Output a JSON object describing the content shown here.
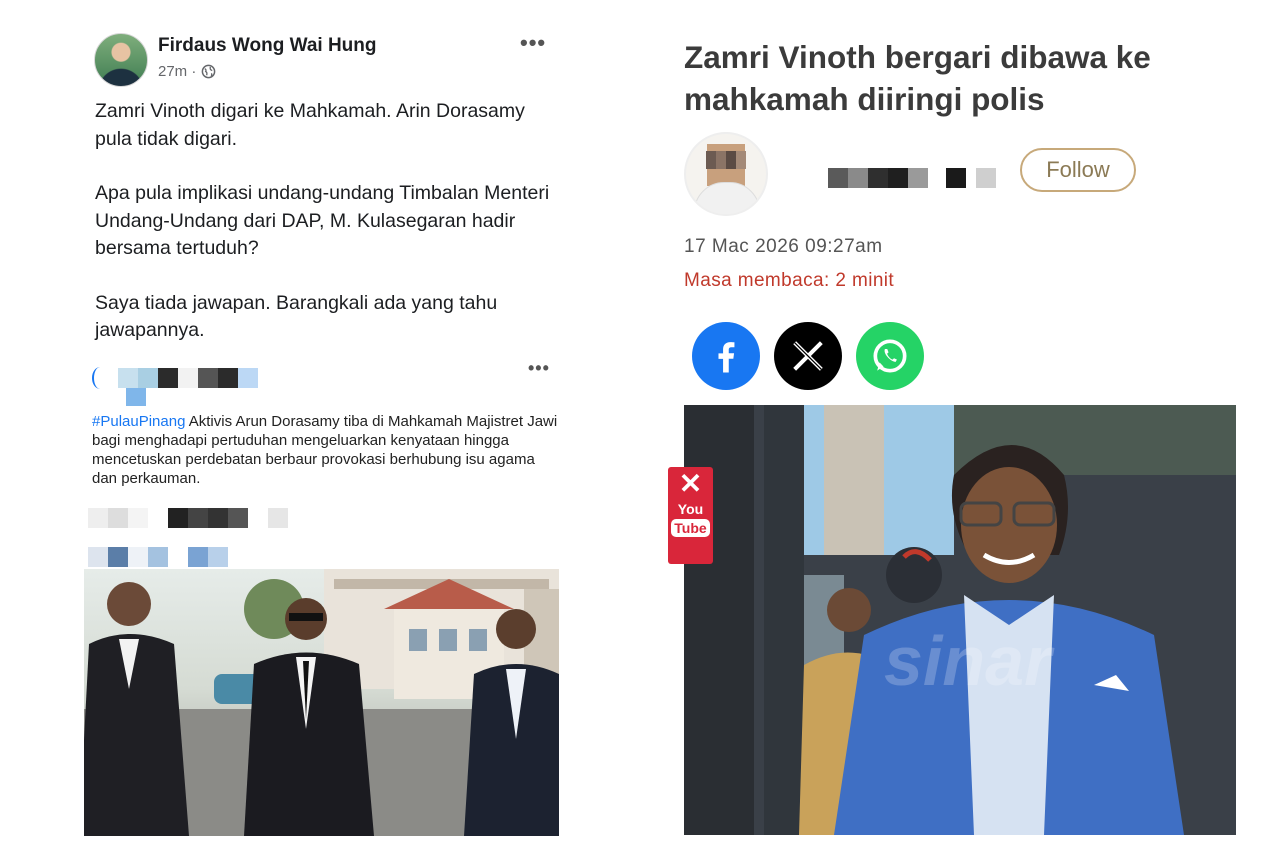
{
  "fb_post": {
    "author": "Firdaus Wong Wai Hung",
    "time": "27m ·",
    "more": "•••",
    "paragraphs": [
      "Zamri Vinoth digari ke Mahkamah. Arin Dorasamy pula tidak digari.",
      "Apa pula implikasi undang-undang Timbalan Menteri Undang-Undang dari DAP, M. Kulasegaran hadir bersama tertuduh?",
      "Saya tiada jawapan. Barangkali ada yang tahu jawapannya."
    ],
    "shared": {
      "more": "•••",
      "hashtag": "#PulauPinang",
      "text": " Aktivis Arun Dorasamy tiba di Mahkamah Majistret Jawi bagi menghadapi pertuduhan mengeluarkan kenyataan hingga mencetuskan perdebatan berbaur provokasi berhubung isu agama dan perkauman."
    }
  },
  "article": {
    "title": "Zamri Vinoth bergari dibawa ke mahkamah diiringi polis",
    "follow_label": "Follow",
    "date": "17 Mac 2026 09:27am",
    "read_time": "Masa membaca: 2 minit",
    "yt_you": "You",
    "yt_tube": "Tube",
    "yt_close": "✕"
  },
  "colors": {
    "fb_blue": "#1877f2",
    "read_time_red": "#c0392b",
    "follow_gold": "#c7a97a",
    "whatsapp_green": "#25d366",
    "youtube_red": "#d9263a"
  }
}
